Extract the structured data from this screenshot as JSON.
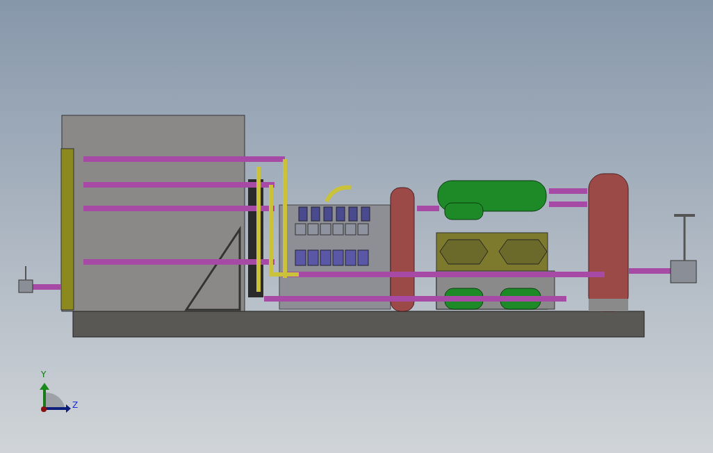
{
  "viewport": {
    "axis_triad": {
      "vertical_label": "Y",
      "horizontal_label": "Z"
    }
  }
}
